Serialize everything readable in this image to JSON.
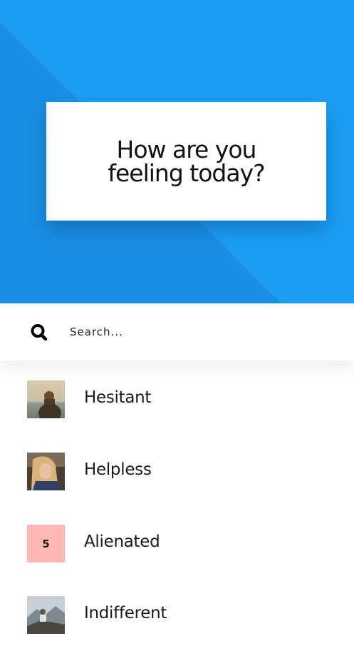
{
  "hero": {
    "question": "How are you feeling today?",
    "background_color": "#1b9ef4",
    "shade_color": "#1a8de0"
  },
  "search": {
    "placeholder": "Search...",
    "icon": "search-icon"
  },
  "feelings": [
    {
      "label": "Hesitant",
      "thumbnail": "photo-person-at-sea"
    },
    {
      "label": "Helpless",
      "thumbnail": "photo-woman-blond-hair"
    },
    {
      "label": "Alienated",
      "thumbnail_text": "5",
      "thumbnail_color": "#ffb8b3"
    },
    {
      "label": "Indifferent",
      "thumbnail": "photo-man-on-mountain"
    }
  ]
}
